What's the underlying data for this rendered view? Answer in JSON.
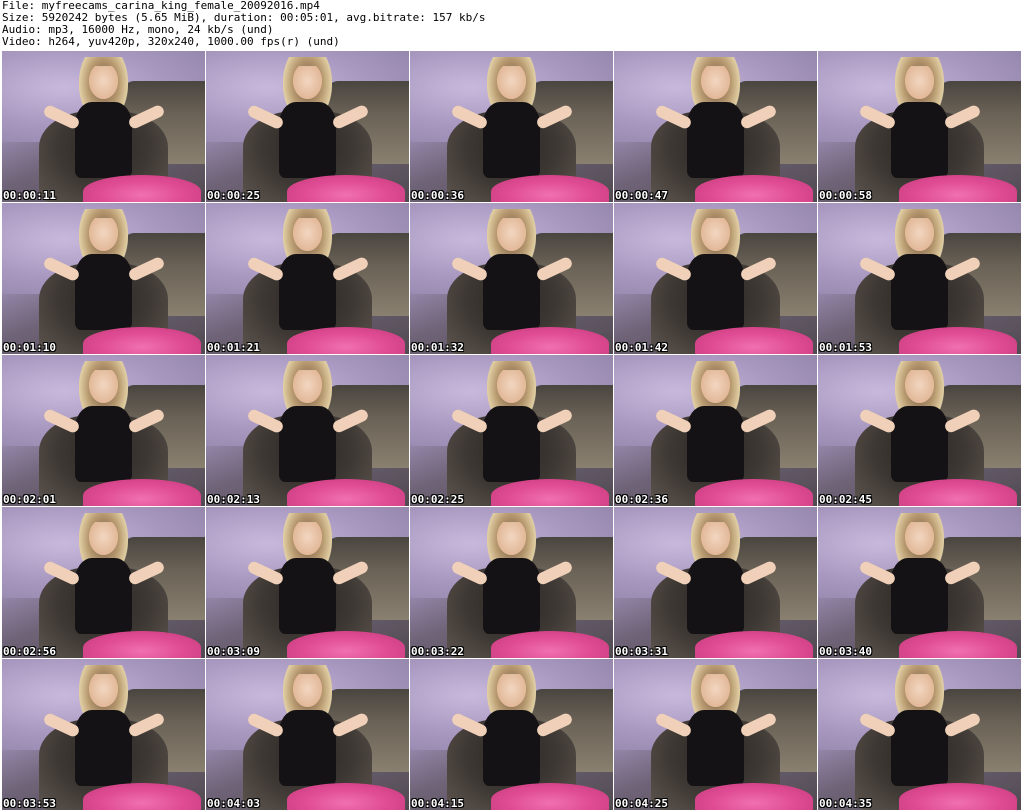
{
  "info": {
    "file": "File: myfreecams_carina_king_female_20092016.mp4",
    "size": "Size: 5920242 bytes (5.65 MiB), duration: 00:05:01, avg.bitrate: 157 kb/s",
    "audio": "Audio: mp3, 16000 Hz, mono, 24 kb/s (und)",
    "video": "Video: h264, yuv420p, 320x240, 1000.00 fps(r) (und)"
  },
  "thumbnails": [
    {
      "time": "00:00:11"
    },
    {
      "time": "00:00:25"
    },
    {
      "time": "00:00:36"
    },
    {
      "time": "00:00:47"
    },
    {
      "time": "00:00:58"
    },
    {
      "time": "00:01:10"
    },
    {
      "time": "00:01:21"
    },
    {
      "time": "00:01:32"
    },
    {
      "time": "00:01:42"
    },
    {
      "time": "00:01:53"
    },
    {
      "time": "00:02:01"
    },
    {
      "time": "00:02:13"
    },
    {
      "time": "00:02:25"
    },
    {
      "time": "00:02:36"
    },
    {
      "time": "00:02:45"
    },
    {
      "time": "00:02:56"
    },
    {
      "time": "00:03:09"
    },
    {
      "time": "00:03:22"
    },
    {
      "time": "00:03:31"
    },
    {
      "time": "00:03:40"
    },
    {
      "time": "00:03:53"
    },
    {
      "time": "00:04:03"
    },
    {
      "time": "00:04:15"
    },
    {
      "time": "00:04:25"
    },
    {
      "time": "00:04:35"
    }
  ]
}
